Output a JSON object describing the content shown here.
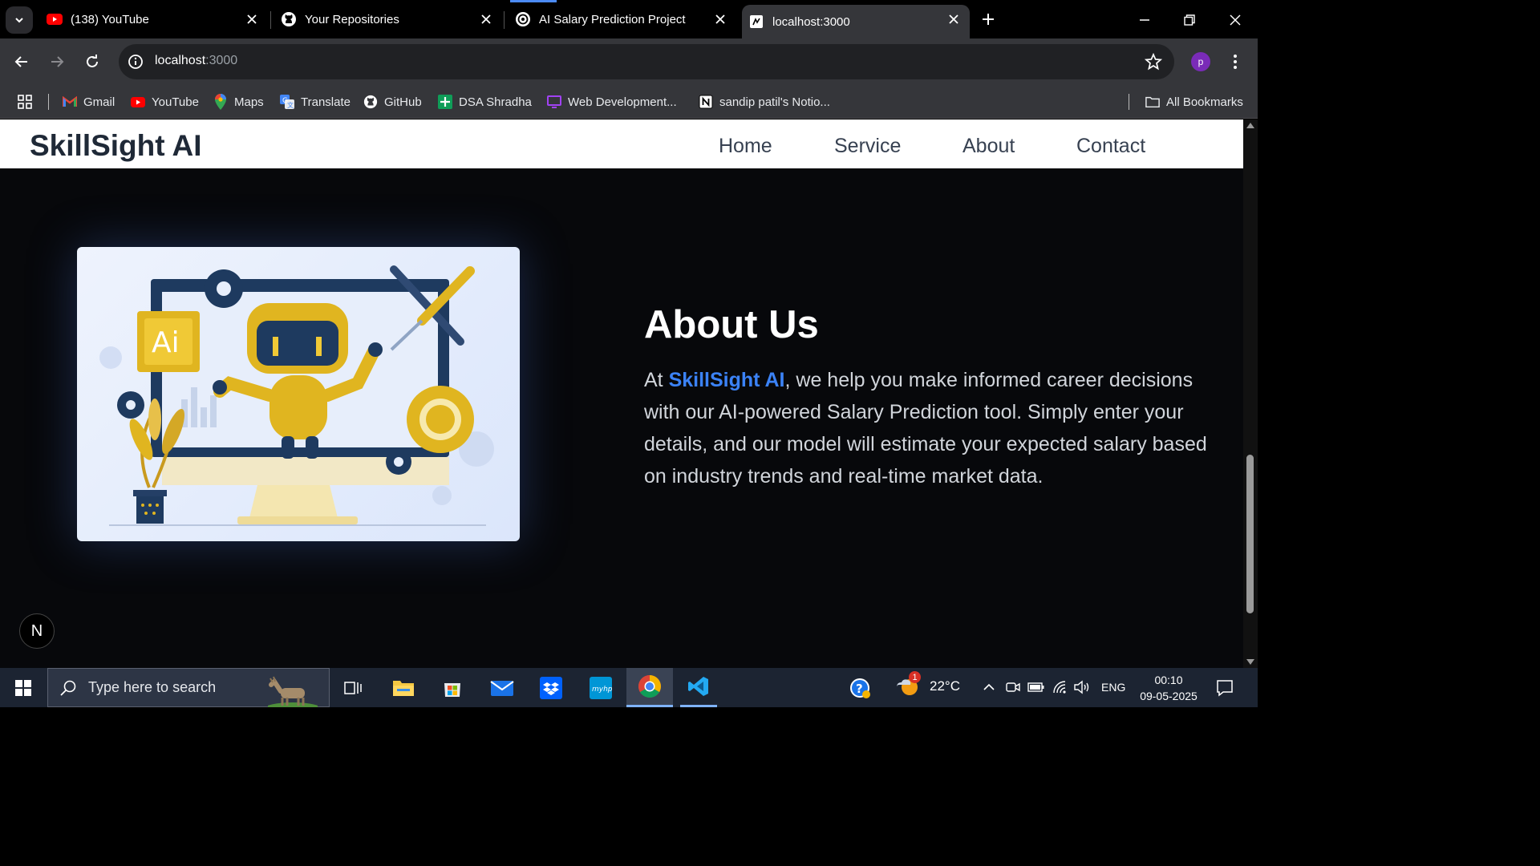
{
  "browser": {
    "tabs": [
      {
        "title": "(138) YouTube",
        "icon": "youtube-icon"
      },
      {
        "title": "Your Repositories",
        "icon": "github-icon"
      },
      {
        "title": "AI Salary Prediction Project",
        "icon": "openai-icon"
      },
      {
        "title": "localhost:3000",
        "icon": "page-icon",
        "active": true
      }
    ],
    "address": {
      "host": "localhost",
      "port": ":3000"
    },
    "profile_initial": "p",
    "bookmarks": [
      {
        "label": "Gmail",
        "icon": "gmail-icon"
      },
      {
        "label": "YouTube",
        "icon": "youtube-icon"
      },
      {
        "label": "Maps",
        "icon": "maps-icon"
      },
      {
        "label": "Translate",
        "icon": "translate-icon"
      },
      {
        "label": "GitHub",
        "icon": "github-icon"
      },
      {
        "label": "DSA Shradha",
        "icon": "sheets-icon"
      },
      {
        "label": "Web Development...",
        "icon": "monitor-icon"
      },
      {
        "label": "sandip patil's Notio...",
        "icon": "notion-icon"
      }
    ],
    "all_bookmarks": "All Bookmarks"
  },
  "site": {
    "brand": "SkillSight AI",
    "nav": [
      "Home",
      "Service",
      "About",
      "Contact"
    ],
    "about": {
      "title": "About Us",
      "text_before": "At ",
      "highlight": "SkillSight AI",
      "text_after": ", we help you make informed career decisions with our AI-powered Salary Prediction tool. Simply enter your details, and our model will estimate your expected salary based on industry trends and real-time market data."
    },
    "illustration_label": "Ai",
    "dev_badge": "N",
    "colors": {
      "accent": "#3b82f6",
      "page_bg": "#07080b",
      "brand": "#1f2937"
    }
  },
  "taskbar": {
    "search_placeholder": "Type here to search",
    "weather": "22°C",
    "weather_badge": "1",
    "language": "ENG",
    "time": "00:10",
    "date": "09-05-2025"
  }
}
